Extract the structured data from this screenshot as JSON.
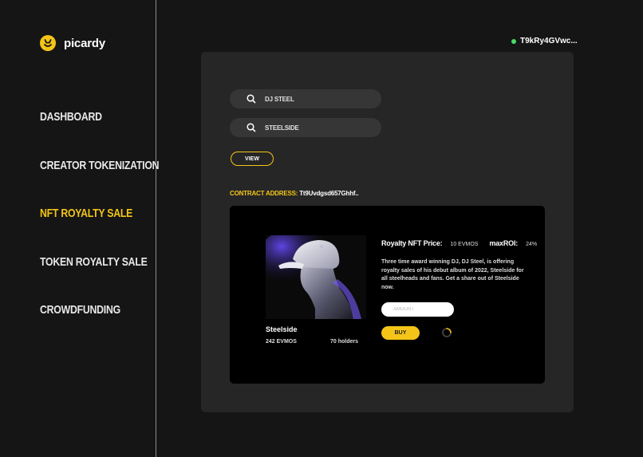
{
  "brand": {
    "name": "picardy",
    "accent": "#f4c518"
  },
  "nav": {
    "items": [
      {
        "label": "DASHBOARD"
      },
      {
        "label": "CREATOR TOKENIZATION"
      },
      {
        "label": "NFT ROYALTY SALE"
      },
      {
        "label": "TOKEN ROYALTY SALE"
      },
      {
        "label": "CROWDFUNDING"
      }
    ],
    "active_index": 2
  },
  "wallet": {
    "address": "T9kRy4GVwc...",
    "status_color": "#4cd964"
  },
  "search": {
    "artist_value": "DJ STEEL",
    "title_value": "STEELSIDE",
    "icon": "search-icon"
  },
  "view_button": {
    "label": "VIEW"
  },
  "contract": {
    "label": "CONTRACT ADDRESS:",
    "value": "Tt9Uvdgsd657Ghhf.."
  },
  "nft": {
    "name": "Steelside",
    "evmos": "242 EVMOS",
    "holders": "70 holders",
    "price_label": "Royalty NFT Price:",
    "price_value": "10 EVMOS",
    "roi_label": "maxROI:",
    "roi_value": "24%",
    "description": "Three time award winning DJ, DJ Steel, is offering royalty sales of his debut album of 2022, Steelside for all steelheads and fans. Get a share out of Steelside now.",
    "amount_placeholder": "AMOUNT",
    "buy_label": "BUY"
  }
}
